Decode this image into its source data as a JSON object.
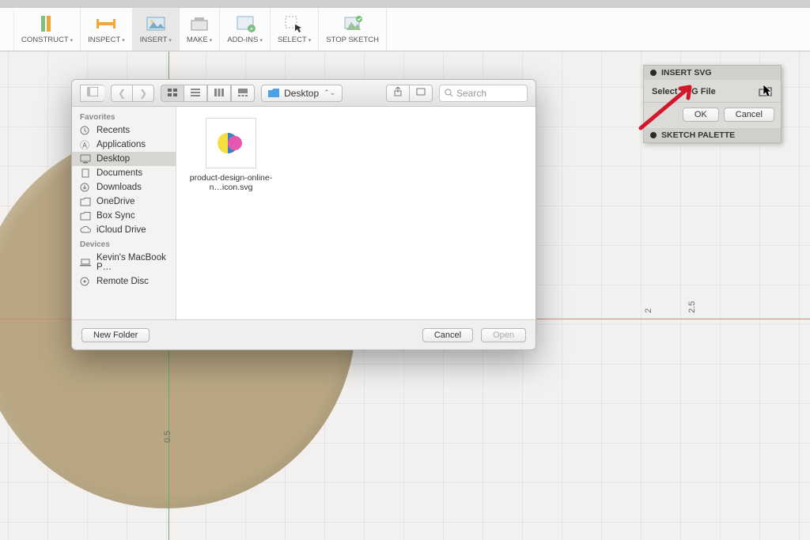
{
  "toolbar": {
    "construct": "CONSTRUCT",
    "inspect": "INSPECT",
    "insert": "INSERT",
    "make": "MAKE",
    "addins": "ADD-INS",
    "select": "SELECT",
    "stop_sketch": "STOP SKETCH"
  },
  "panel": {
    "title": "INSERT SVG",
    "select_label": "Select SVG File",
    "ok": "OK",
    "cancel": "Cancel",
    "palette_title": "SKETCH PALETTE"
  },
  "dimensions": {
    "a": "0.5",
    "b": "2",
    "c": "2.5"
  },
  "finder": {
    "location": "Desktop",
    "search_placeholder": "Search",
    "side_sections": {
      "favorites": "Favorites",
      "devices": "Devices"
    },
    "favorites": [
      {
        "label": "Recents",
        "icon": "recents"
      },
      {
        "label": "Applications",
        "icon": "apps"
      },
      {
        "label": "Desktop",
        "icon": "desktop",
        "selected": true
      },
      {
        "label": "Documents",
        "icon": "docs"
      },
      {
        "label": "Downloads",
        "icon": "downloads"
      },
      {
        "label": "OneDrive",
        "icon": "folder"
      },
      {
        "label": "Box Sync",
        "icon": "folder"
      },
      {
        "label": "iCloud Drive",
        "icon": "cloud"
      }
    ],
    "devices": [
      {
        "label": "Kevin's MacBook P…",
        "icon": "laptop"
      },
      {
        "label": "Remote Disc",
        "icon": "disc"
      }
    ],
    "files": [
      {
        "name": "product-design-online-n…icon.svg"
      }
    ],
    "new_folder": "New Folder",
    "cancel": "Cancel",
    "open": "Open"
  }
}
